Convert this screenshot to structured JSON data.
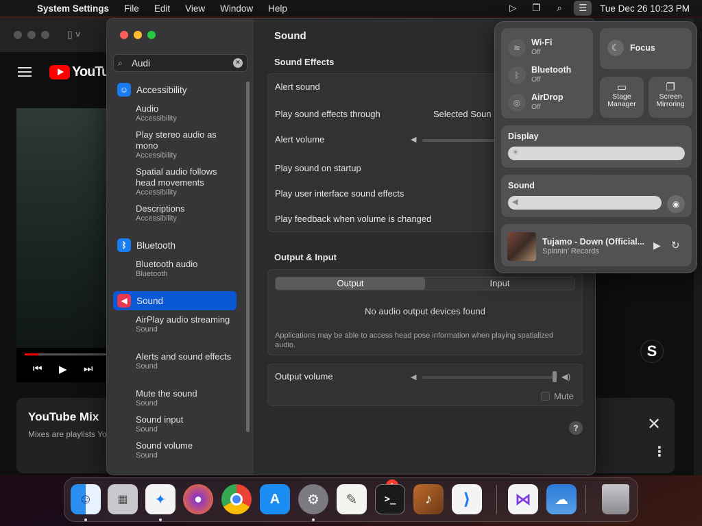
{
  "menubar": {
    "app_name": "System Settings",
    "menus": [
      "File",
      "Edit",
      "View",
      "Window",
      "Help"
    ],
    "clock": "Tue Dec 26  10:23 PM"
  },
  "browser": {
    "logo_text": "YouTube",
    "mix_title": "YouTube Mix",
    "mix_subtitle": "Mixes are playlists Yo"
  },
  "settings": {
    "search": {
      "value": "Audi"
    },
    "sidebar": [
      {
        "type": "category",
        "label": "Accessibility",
        "icon": "accessibility-icon",
        "color": "#1a7cf2"
      },
      {
        "type": "result",
        "label": "Audio",
        "sub": "Accessibility"
      },
      {
        "type": "result",
        "label": "Play stereo audio as mono",
        "sub": "Accessibility"
      },
      {
        "type": "result",
        "label": "Spatial audio follows head movements",
        "sub": "Accessibility"
      },
      {
        "type": "result",
        "label": "Descriptions",
        "sub": "Accessibility"
      },
      {
        "type": "category",
        "label": "Bluetooth",
        "icon": "bluetooth-icon",
        "color": "#1a7cf2"
      },
      {
        "type": "result",
        "label": "Bluetooth audio",
        "sub": "Bluetooth"
      },
      {
        "type": "category",
        "label": "Sound",
        "icon": "speaker-icon",
        "color": "#e8384f",
        "selected": true
      },
      {
        "type": "result",
        "label": "AirPlay audio streaming",
        "sub": "Sound"
      },
      {
        "type": "result",
        "label": "Alerts and sound effects",
        "sub": "Sound"
      },
      {
        "type": "result",
        "label": "Mute the sound",
        "sub": "Sound"
      },
      {
        "type": "result",
        "label": "Sound input",
        "sub": "Sound"
      },
      {
        "type": "result",
        "label": "Sound volume",
        "sub": "Sound"
      }
    ],
    "pane_title": "Sound",
    "sound_effects": {
      "title": "Sound Effects",
      "alert_sound": "Alert sound",
      "play_through": "Play sound effects through",
      "play_through_value": "Selected Soun",
      "alert_volume": "Alert volume",
      "startup": "Play sound on startup",
      "ui_effects": "Play user interface sound effects",
      "feedback": "Play feedback when volume is changed"
    },
    "output_input": {
      "title": "Output & Input",
      "tab_output": "Output",
      "tab_input": "Input",
      "no_devices": "No audio output devices found",
      "head_pose_note": "Applications may be able to access head pose information when playing spatialized audio."
    },
    "output_volume": {
      "label": "Output volume",
      "mute": "Mute",
      "level": 1.0
    },
    "help": "?"
  },
  "control_center": {
    "wifi": {
      "name": "Wi-Fi",
      "state": "Off"
    },
    "bluetooth": {
      "name": "Bluetooth",
      "state": "Off"
    },
    "airdrop": {
      "name": "AirDrop",
      "state": "Off"
    },
    "focus": "Focus",
    "stage_manager": "Stage Manager",
    "screen_mirroring": "Screen Mirroring",
    "display_label": "Display",
    "sound_label": "Sound",
    "now_playing": {
      "title": "Tujamo - Down (Official...",
      "artist": "Spinnin' Records"
    }
  },
  "dock": {
    "apps": [
      "Finder",
      "Launchpad",
      "Safari",
      "Firefox",
      "Chrome",
      "App Store",
      "System Settings",
      "TextEdit",
      "Terminal",
      "GarageBand",
      "Visual Studio Code",
      "Visual Studio",
      "Weather",
      "Trash"
    ],
    "settings_badge": "1"
  }
}
